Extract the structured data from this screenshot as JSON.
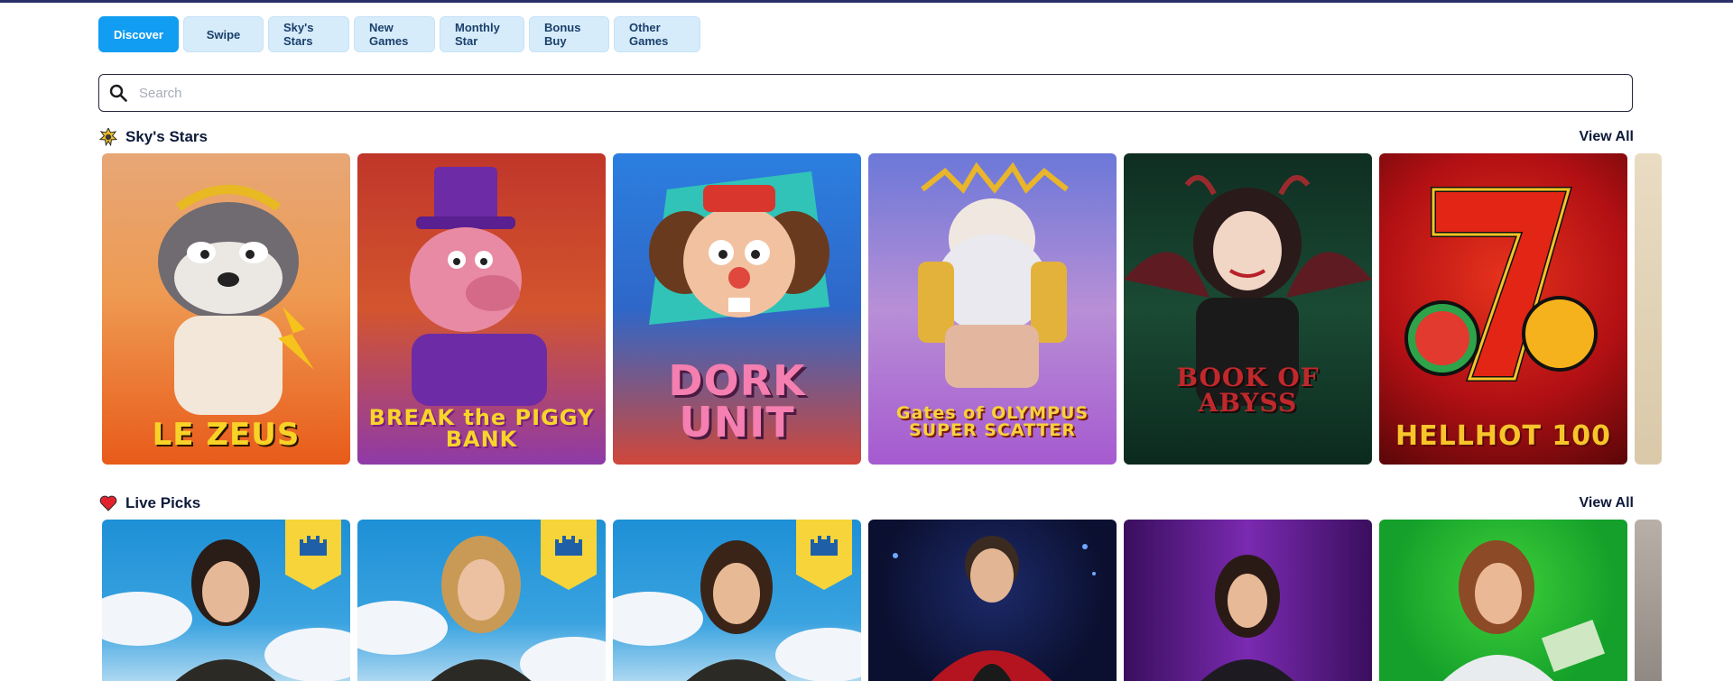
{
  "tabs": [
    {
      "label": "Discover",
      "active": true
    },
    {
      "label": "Swipe"
    },
    {
      "label": "Sky's Stars"
    },
    {
      "label": "New Games"
    },
    {
      "label": "Monthly Star"
    },
    {
      "label": "Bonus Buy"
    },
    {
      "label": "Other Games"
    }
  ],
  "search": {
    "placeholder": "Search",
    "icon": "search-icon"
  },
  "sections": [
    {
      "title": "Sky's Stars",
      "icon": "star-badge-icon",
      "view_all": "View All",
      "games": [
        {
          "name": "LE ZEUS"
        },
        {
          "name": "BREAK the PIGGY BANK"
        },
        {
          "name": "DORK UNIT"
        },
        {
          "name": "Gates of OLYMPUS SUPER SCATTER"
        },
        {
          "name": "BOOK OF ABYSS"
        },
        {
          "name": "HELLHOT 100"
        }
      ]
    },
    {
      "title": "Live Picks",
      "icon": "heart-icon",
      "view_all": "View All"
    }
  ],
  "colors": {
    "accent": "#119df2",
    "tab_bg": "#d6ecfb",
    "text": "#0e1a3a"
  }
}
